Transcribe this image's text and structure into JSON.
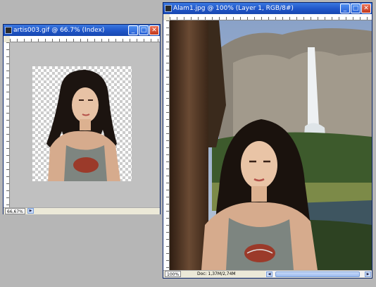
{
  "window_left": {
    "title": "artis003.gif @ 66.7% (Index)",
    "zoom": "66,67%",
    "canvas_bg": "#c0c0c0"
  },
  "window_right": {
    "title": "Alam1.jpg @ 100% (Layer 1, RGB/8#)",
    "zoom": "100%",
    "doc_info": "Doc: 1,37M/2,74M"
  },
  "colors": {
    "titlebar": "#2458c8",
    "workspace": "#b6b6b6",
    "window_frame": "#ece9d8"
  },
  "icons": {
    "app_icon": "photoshop-doc-icon",
    "minimize": "minimize-icon",
    "maximize": "maximize-icon",
    "close": "close-icon"
  },
  "buttons": {
    "minimize_glyph": "_",
    "maximize_glyph": "□",
    "close_glyph": "✕",
    "scroll_left_glyph": "◀",
    "scroll_right_glyph": "▶"
  }
}
